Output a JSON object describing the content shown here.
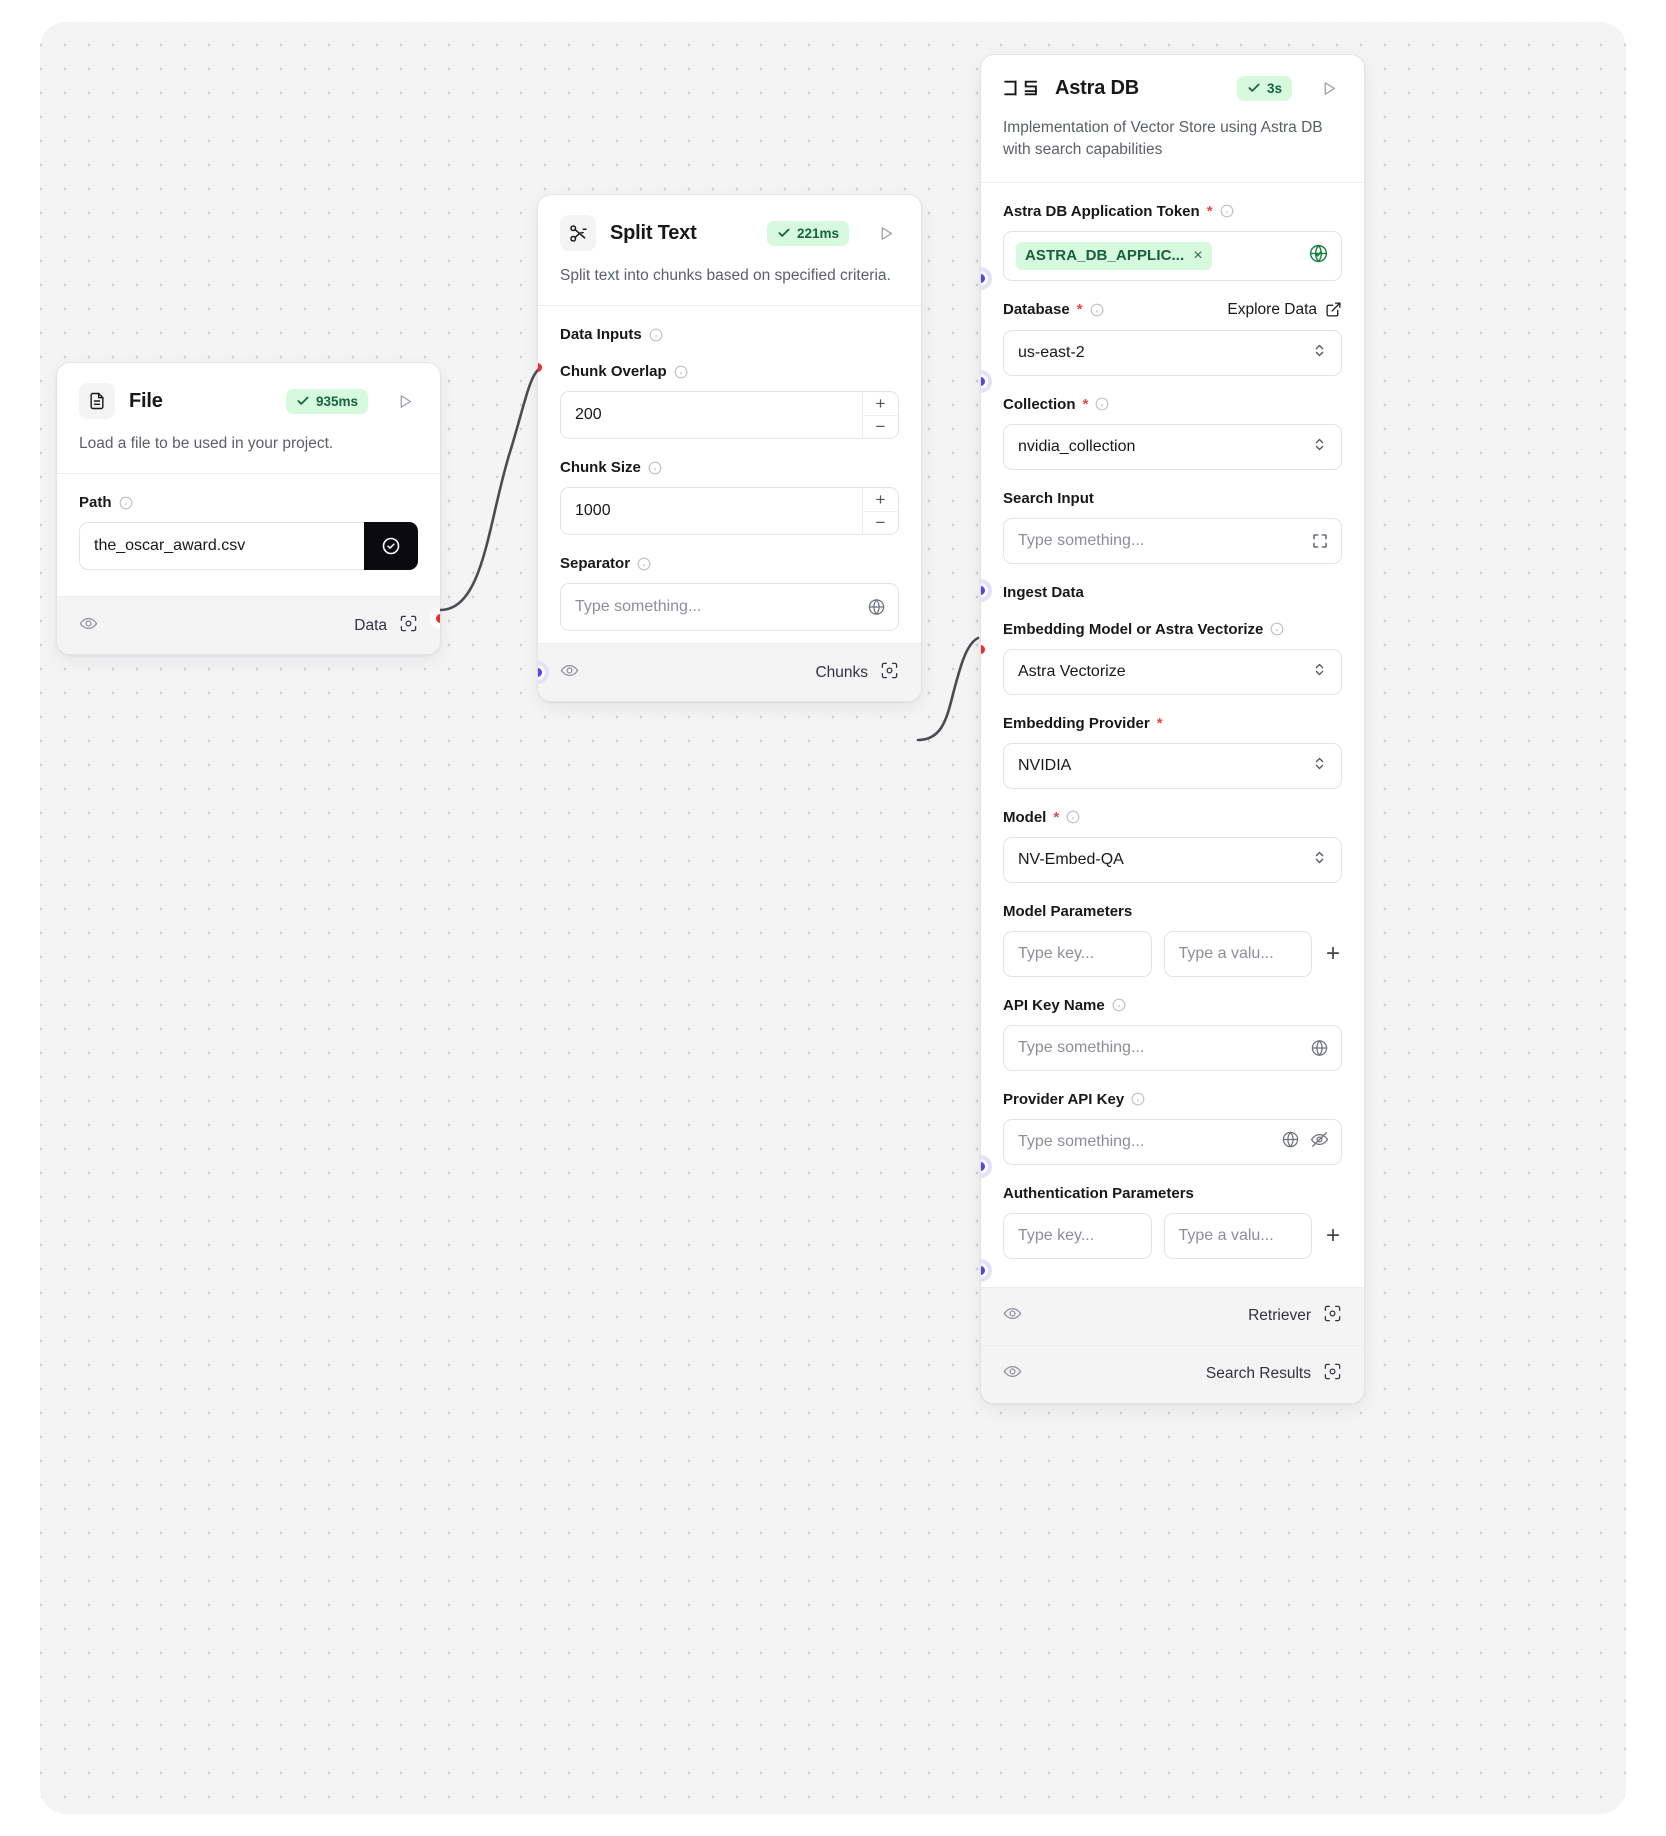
{
  "canvas": {
    "grid": true,
    "bg": "#f4f4f5",
    "dot_color": "#cfcfd4"
  },
  "nodes": {
    "file": {
      "title": "File",
      "icon": "file-document-icon",
      "badge": "935ms",
      "description": "Load a file to be used in your project.",
      "fields": [
        {
          "label": "Path",
          "value": "the_oscar_award.csv",
          "has_info": true
        }
      ],
      "output_label": "Data"
    },
    "split_text": {
      "title": "Split Text",
      "icon": "scissors-icon",
      "badge": "221ms",
      "description": "Split text into chunks based on specified criteria.",
      "section_label": "Data Inputs",
      "fields": [
        {
          "label": "Chunk Overlap",
          "value": "200",
          "has_info": true
        },
        {
          "label": "Chunk Size",
          "value": "1000",
          "has_info": true
        },
        {
          "label": "Separator",
          "placeholder": "Type something...",
          "has_info": true
        }
      ],
      "output_label": "Chunks"
    },
    "astra_db": {
      "title": "Astra DB",
      "icon": "datastax-ds-icon",
      "badge": "3s",
      "description": "Implementation of Vector Store using Astra DB with search capabilities",
      "token_field": {
        "label": "Astra DB Application Token",
        "required": true,
        "chip": "ASTRA_DB_APPLIC...",
        "chip_remove": "×"
      },
      "database_field": {
        "label": "Database",
        "required": true,
        "explore_label": "Explore Data",
        "value": "us-east-2"
      },
      "collection_field": {
        "label": "Collection",
        "required": true,
        "value": "nvidia_collection"
      },
      "search_input": {
        "label": "Search Input",
        "placeholder": "Type something..."
      },
      "ingest_label": "Ingest Data",
      "embedding_model": {
        "label": "Embedding Model or Astra Vectorize",
        "has_info": true,
        "value": "Astra Vectorize"
      },
      "embedding_provider": {
        "label": "Embedding Provider",
        "required": true,
        "value": "NVIDIA"
      },
      "model": {
        "label": "Model",
        "required": true,
        "has_info": true,
        "value": "NV-Embed-QA"
      },
      "model_parameters": {
        "label": "Model Parameters",
        "key_placeholder": "Type key...",
        "value_placeholder": "Type a valu...",
        "add": "+"
      },
      "api_key_name": {
        "label": "API Key Name",
        "has_info": true,
        "placeholder": "Type something..."
      },
      "provider_api_key": {
        "label": "Provider API Key",
        "has_info": true,
        "placeholder": "Type something..."
      },
      "auth_parameters": {
        "label": "Authentication Parameters",
        "key_placeholder": "Type key...",
        "value_placeholder": "Type a valu...",
        "add": "+"
      },
      "outputs": [
        {
          "label": "Retriever"
        },
        {
          "label": "Search Results"
        }
      ]
    }
  },
  "colors": {
    "success_badge_bg": "#d7fadf",
    "success_badge_fg": "#14663a",
    "port_red": "#ef2b2b",
    "port_blue": "#4f46e5",
    "port_grey": "#3f4350",
    "required_star": "#ef4444"
  }
}
